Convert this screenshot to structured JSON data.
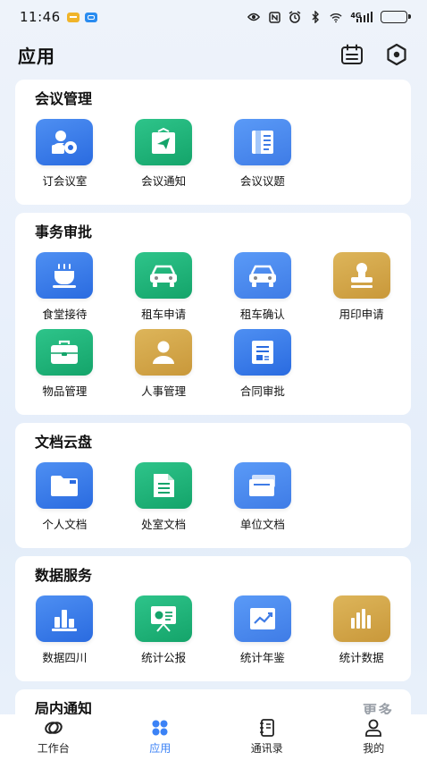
{
  "status_bar": {
    "time": "11:46",
    "network": "4G",
    "battery_level": 0.8
  },
  "header": {
    "title": "应用",
    "icons": [
      "calendar-list-icon",
      "hexagon-settings-icon"
    ]
  },
  "sections": [
    {
      "title": "会议管理",
      "apps": [
        {
          "label": "订会议室",
          "color": "blue",
          "icon": "meeting-room-icon"
        },
        {
          "label": "会议通知",
          "color": "green",
          "icon": "notice-icon"
        },
        {
          "label": "会议议题",
          "color": "lblue",
          "icon": "agenda-icon"
        }
      ]
    },
    {
      "title": "事务审批",
      "apps": [
        {
          "label": "食堂接待",
          "color": "blue",
          "icon": "canteen-icon"
        },
        {
          "label": "租车申请",
          "color": "green",
          "icon": "car-icon"
        },
        {
          "label": "租车确认",
          "color": "lblue",
          "icon": "car-icon"
        },
        {
          "label": "用印申请",
          "color": "gold",
          "icon": "seal-icon"
        },
        {
          "label": "物品管理",
          "color": "green",
          "icon": "briefcase-icon"
        },
        {
          "label": "人事管理",
          "color": "gold",
          "icon": "person-icon"
        },
        {
          "label": "合同审批",
          "color": "blue",
          "icon": "contract-icon"
        }
      ]
    },
    {
      "title": "文档云盘",
      "apps": [
        {
          "label": "个人文档",
          "color": "blue",
          "icon": "folder-icon"
        },
        {
          "label": "处室文档",
          "color": "green",
          "icon": "document-icon"
        },
        {
          "label": "单位文档",
          "color": "lblue",
          "icon": "archive-icon"
        }
      ]
    },
    {
      "title": "数据服务",
      "apps": [
        {
          "label": "数据四川",
          "color": "blue",
          "icon": "bar-chart-icon"
        },
        {
          "label": "统计公报",
          "color": "green",
          "icon": "presentation-icon"
        },
        {
          "label": "统计年鉴",
          "color": "lblue",
          "icon": "trend-chart-icon"
        },
        {
          "label": "统计数据",
          "color": "gold",
          "icon": "columns-chart-icon"
        }
      ]
    }
  ],
  "notice_section": {
    "title": "局内通知",
    "more": "更多"
  },
  "bottom_nav": [
    {
      "label": "工作台",
      "icon": "workbench-icon",
      "active": false
    },
    {
      "label": "应用",
      "icon": "apps-icon",
      "active": true
    },
    {
      "label": "通讯录",
      "icon": "contacts-icon",
      "active": false
    },
    {
      "label": "我的",
      "icon": "profile-icon",
      "active": false
    }
  ],
  "colors": {
    "blue": "#2a6be0",
    "green": "#14a46a",
    "gold": "#c9983a",
    "active_nav": "#3b82f6"
  }
}
